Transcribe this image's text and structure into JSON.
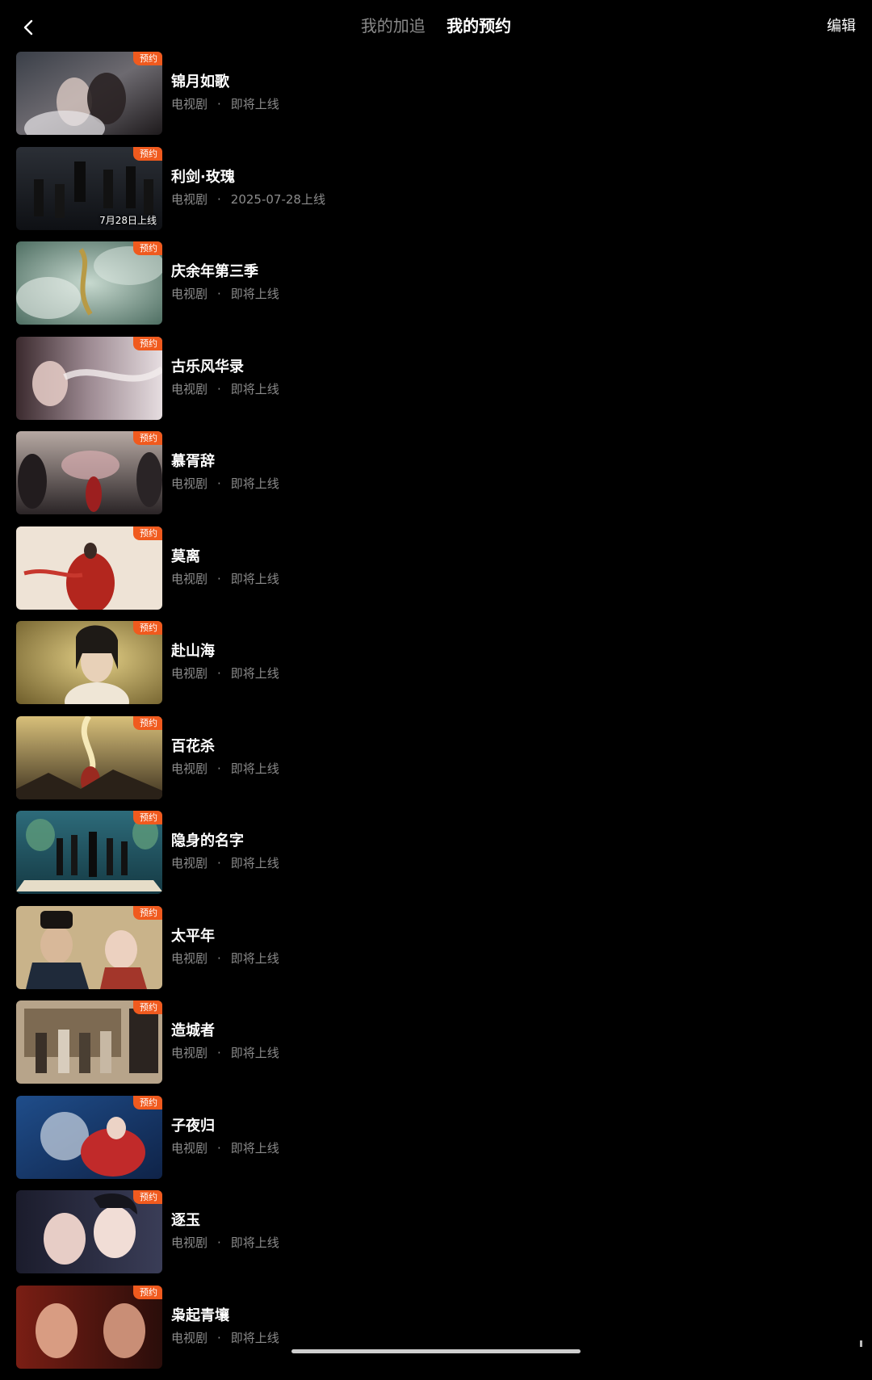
{
  "header": {
    "tabs": [
      {
        "label": "我的加追",
        "active": false
      },
      {
        "label": "我的预约",
        "active": true
      }
    ],
    "edit_label": "编辑"
  },
  "icons": {
    "back": "chevron-left-icon"
  },
  "colors": {
    "background": "#000000",
    "badge": "#f05a1e",
    "meta_text": "#8c8c8c"
  },
  "badge_label": "预约",
  "items": [
    {
      "title": "锦月如歌",
      "category": "电视剧",
      "dot": "·",
      "status": "即将上线",
      "date_overlay": ""
    },
    {
      "title": "利剑·玫瑰",
      "category": "电视剧",
      "dot": "·",
      "status": "2025-07-28上线",
      "date_overlay": "7月28日上线"
    },
    {
      "title": "庆余年第三季",
      "category": "电视剧",
      "dot": "·",
      "status": "即将上线",
      "date_overlay": ""
    },
    {
      "title": "古乐风华录",
      "category": "电视剧",
      "dot": "·",
      "status": "即将上线",
      "date_overlay": ""
    },
    {
      "title": "慕胥辞",
      "category": "电视剧",
      "dot": "·",
      "status": "即将上线",
      "date_overlay": ""
    },
    {
      "title": "莫离",
      "category": "电视剧",
      "dot": "·",
      "status": "即将上线",
      "date_overlay": ""
    },
    {
      "title": "赴山海",
      "category": "电视剧",
      "dot": "·",
      "status": "即将上线",
      "date_overlay": ""
    },
    {
      "title": "百花杀",
      "category": "电视剧",
      "dot": "·",
      "status": "即将上线",
      "date_overlay": ""
    },
    {
      "title": "隐身的名字",
      "category": "电视剧",
      "dot": "·",
      "status": "即将上线",
      "date_overlay": ""
    },
    {
      "title": "太平年",
      "category": "电视剧",
      "dot": "·",
      "status": "即将上线",
      "date_overlay": ""
    },
    {
      "title": "造城者",
      "category": "电视剧",
      "dot": "·",
      "status": "即将上线",
      "date_overlay": ""
    },
    {
      "title": "子夜归",
      "category": "电视剧",
      "dot": "·",
      "status": "即将上线",
      "date_overlay": ""
    },
    {
      "title": "逐玉",
      "category": "电视剧",
      "dot": "·",
      "status": "即将上线",
      "date_overlay": ""
    },
    {
      "title": "枭起青壤",
      "category": "电视剧",
      "dot": "·",
      "status": "即将上线",
      "date_overlay": ""
    }
  ]
}
